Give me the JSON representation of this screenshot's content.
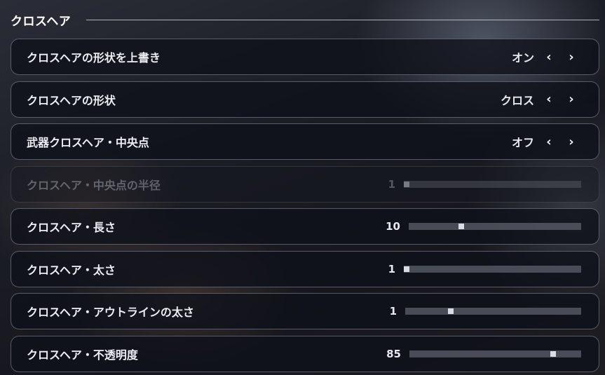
{
  "section": {
    "title": "クロスヘア"
  },
  "rows": [
    {
      "label": "クロスヘアの形状を上書き",
      "type": "toggle",
      "value": "オン"
    },
    {
      "label": "クロスヘアの形状",
      "type": "toggle",
      "value": "クロス"
    },
    {
      "label": "武器クロスヘア・中央点",
      "type": "toggle",
      "value": "オフ"
    },
    {
      "label": "クロスヘア・中央点の半径",
      "type": "slider",
      "value": "1",
      "fraction": 0.0,
      "disabled": true
    },
    {
      "label": "クロスヘア・長さ",
      "type": "slider",
      "value": "10",
      "fraction": 0.3
    },
    {
      "label": "クロスヘア・太さ",
      "type": "slider",
      "value": "1",
      "fraction": 0.0
    },
    {
      "label": "クロスヘア・アウトラインの太さ",
      "type": "slider",
      "value": "1",
      "fraction": 0.25
    },
    {
      "label": "クロスヘア・不透明度",
      "type": "slider",
      "value": "85",
      "fraction": 0.85
    }
  ],
  "icons": {
    "prev": "chevron-left-icon",
    "next": "chevron-right-icon"
  },
  "glyphs": {
    "prev": "‹",
    "next": "›"
  }
}
